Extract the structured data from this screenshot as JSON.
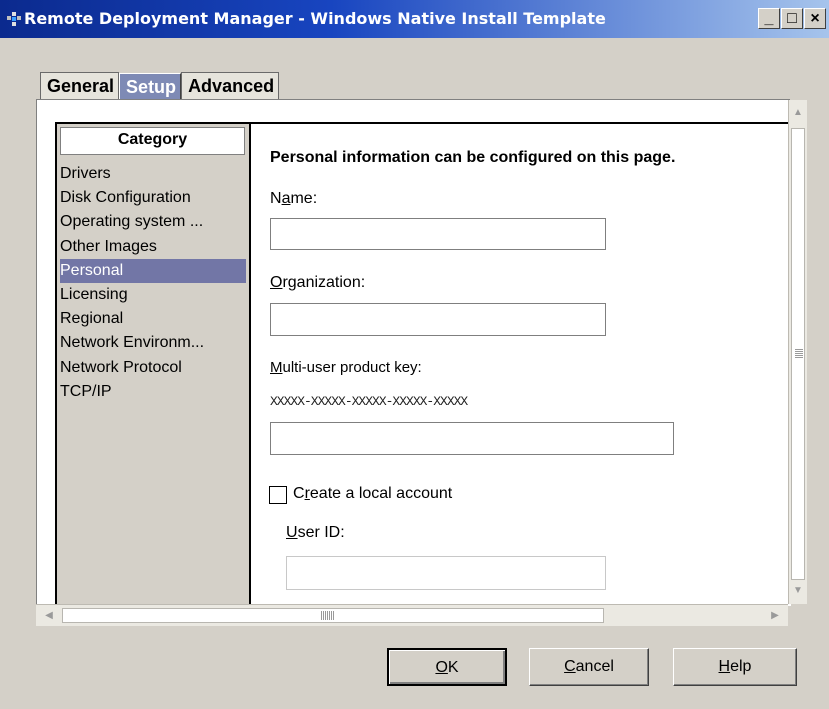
{
  "window": {
    "title": "Remote Deployment Manager - Windows Native Install Template",
    "controls": {
      "minimize": "_",
      "maximize": "□",
      "close": "×"
    }
  },
  "tabs": [
    {
      "label": "General",
      "active": false
    },
    {
      "label": "Setup",
      "active": true
    },
    {
      "label": "Advanced",
      "active": false
    }
  ],
  "category": {
    "header": "Category",
    "items": [
      "Drivers",
      "Disk Configuration",
      "Operating system ...",
      "Other Images",
      "Personal",
      "Licensing",
      "Regional",
      "Network Environm...",
      "Network Protocol",
      "TCP/IP"
    ],
    "selected": "Personal"
  },
  "form": {
    "heading": "Personal information can be configured on this page.",
    "name": {
      "label": "Name:",
      "mnemonic": "a",
      "value": ""
    },
    "organization": {
      "label": "Organization:",
      "mnemonic": "O",
      "value": ""
    },
    "product_key": {
      "label": "Multi-user product key:",
      "mnemonic": "M",
      "mask": "XXXXX-XXXXX-XXXXX-XXXXX-XXXXX",
      "value": ""
    },
    "local_account": {
      "label": "Create a local account",
      "mnemonic": "r",
      "checked": false
    },
    "user_id": {
      "label": "User ID:",
      "mnemonic": "U",
      "value": "",
      "enabled": false
    }
  },
  "buttons": {
    "ok": "OK",
    "cancel": "Cancel",
    "help": "Help"
  },
  "colors": {
    "title_start": "#0b2a8e",
    "selection": "#7276a6",
    "active_tab": "#7e8ab5",
    "window_bg": "#d4d0c8"
  }
}
